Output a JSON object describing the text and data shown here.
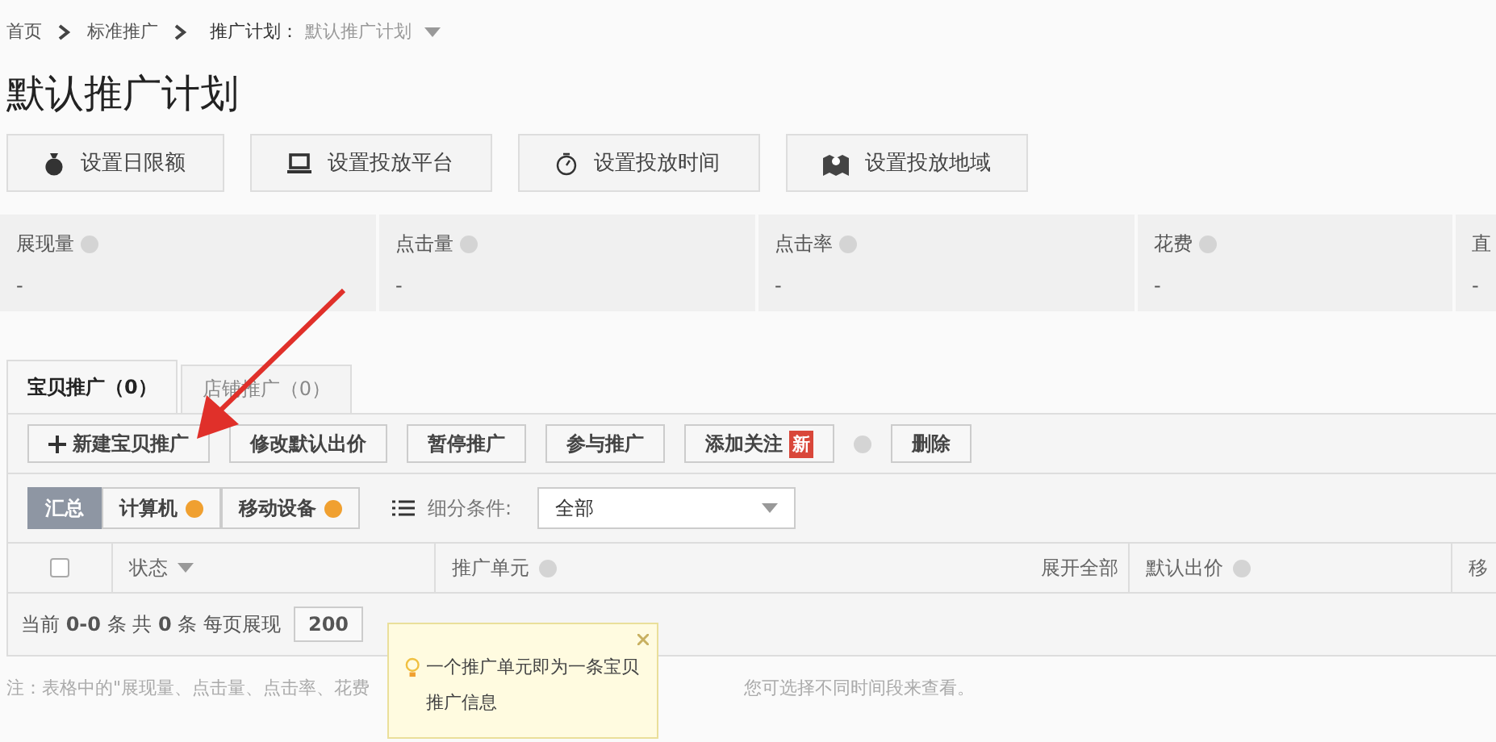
{
  "breadcrumb": [
    {
      "label": "首页"
    },
    {
      "label": "标准推广"
    },
    {
      "label": "推广计划："
    }
  ],
  "plan_selector": "默认推广计划",
  "title": "默认推广计划",
  "setting_buttons": [
    {
      "label": "设置日限额",
      "kind": "budget"
    },
    {
      "label": "设置投放平台",
      "kind": "platform"
    },
    {
      "label": "设置投放时间",
      "kind": "schedule"
    },
    {
      "label": "设置投放地域",
      "kind": "region"
    }
  ],
  "stats": [
    {
      "label": "展现量",
      "value": "-",
      "help": true
    },
    {
      "label": "点击量",
      "value": "-",
      "help": true
    },
    {
      "label": "点击率",
      "value": "-",
      "help": true
    },
    {
      "label": "花费",
      "value": "-",
      "help": true
    },
    {
      "label": "直",
      "value": "-",
      "help": false
    }
  ],
  "tabs": [
    {
      "label": "宝贝推广（0）",
      "selected": true
    },
    {
      "label": "店铺推广（0）",
      "selected": false
    }
  ],
  "actions": [
    {
      "label": "新建宝贝推广",
      "kind": "create"
    },
    {
      "label": "修改默认出价"
    },
    {
      "label": "暂停推广"
    },
    {
      "label": "参与推广"
    },
    {
      "label": "添加关注",
      "badge": "新",
      "help": true
    },
    {
      "label": "删除"
    }
  ],
  "segments": [
    {
      "label": "汇总",
      "selected": true,
      "warning": false
    },
    {
      "label": "计算机",
      "selected": false,
      "warning": true
    },
    {
      "label": "移动设备",
      "selected": false,
      "warning": true
    }
  ],
  "filter": {
    "label": "细分条件:",
    "value": "全部"
  },
  "table": {
    "select_all_checked": false,
    "columns": [
      {
        "label": "状态",
        "kind": "sort"
      },
      {
        "label": "推广单元",
        "kind": "help"
      },
      {
        "label": "展开全部",
        "kind": "link"
      },
      {
        "label": "默认出价",
        "kind": "help"
      },
      {
        "label": "移",
        "kind": "plain"
      }
    ]
  },
  "pagination": {
    "summary": "当前 **0-0** 条 共 **0** 条 每页展现",
    "page_size": "200"
  },
  "tooltip": {
    "text": "一个推广单元即为一条宝贝推广信息"
  },
  "footnote": [
    "注：表格中的\"展现量、点击量、点击率、花费",
    "您可选择不同时间段来查看。"
  ]
}
